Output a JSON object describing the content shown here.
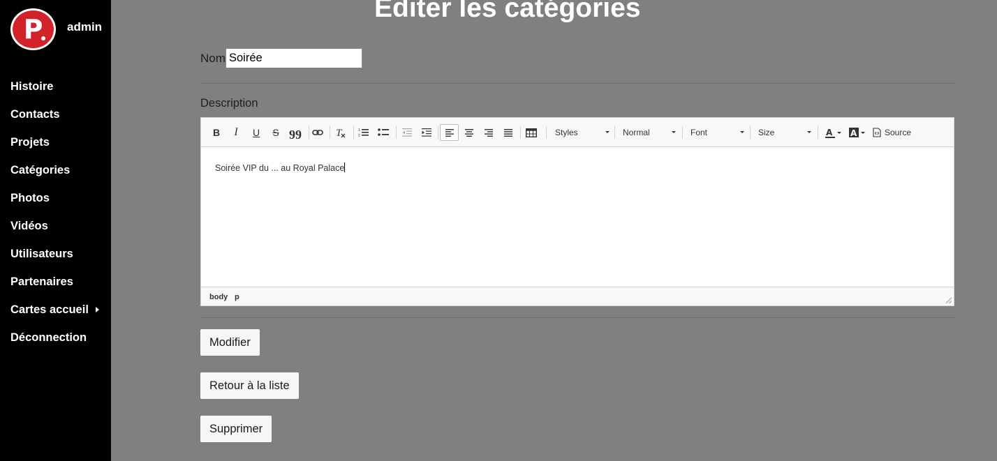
{
  "sidebar": {
    "logo_letter": "P",
    "user": "admin",
    "items": [
      {
        "label": "Histoire"
      },
      {
        "label": "Contacts"
      },
      {
        "label": "Projets"
      },
      {
        "label": "Catégories"
      },
      {
        "label": "Photos"
      },
      {
        "label": "Vidéos"
      },
      {
        "label": "Utilisateurs"
      },
      {
        "label": "Partenaires"
      },
      {
        "label": "Cartes accueil",
        "has_submenu": true
      },
      {
        "label": "Déconnection"
      }
    ]
  },
  "main": {
    "title": "Editer les catégories",
    "nom_label": "Nom",
    "nom_value": "Soirée",
    "description_label": "Description",
    "editor": {
      "toolbar": {
        "bold": "B",
        "italic": "I",
        "underline": "U",
        "strike": "S",
        "blockquote": "99",
        "styles": "Styles",
        "format": "Normal",
        "font": "Font",
        "size": "Size",
        "source": "Source"
      },
      "content": "Soirée VIP du ... au Royal Palace",
      "path": [
        "body",
        "p"
      ]
    },
    "buttons": {
      "modify": "Modifier",
      "back": "Retour à la liste",
      "delete": "Supprimer"
    }
  },
  "colors": {
    "background": "#808080",
    "sidebar": "#000000",
    "logo": "#d2232a"
  }
}
